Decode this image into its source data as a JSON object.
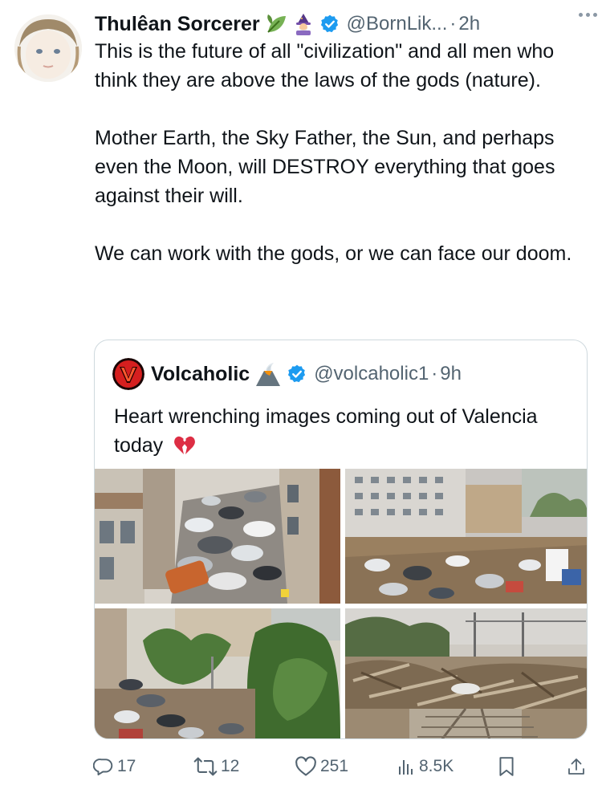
{
  "tweet": {
    "author_name": "Thulêan Sorcerer",
    "author_emojis": [
      "leaf-icon",
      "mage-icon"
    ],
    "handle": "@BornLik...",
    "separator": "·",
    "time": "2h",
    "paragraphs": [
      "This is the future of all \"civilization\" and all men who think they are above the laws of the gods (nature).",
      "Mother Earth, the Sky Father, the Sun, and perhaps even the Moon, will DESTROY everything that goes against their will.",
      "We can work with the gods, or we can face our doom."
    ]
  },
  "quoted": {
    "author_name": "Volcaholic",
    "author_emoji": "volcano-icon",
    "handle": "@volcaholic1",
    "separator": "·",
    "time": "9h",
    "text": "Heart wrenching images coming out of Valencia today",
    "text_emoji": "broken-heart-icon",
    "images": [
      "flood-cars-street-photo",
      "flood-plaza-photo",
      "flood-trees-photo",
      "flood-debris-railway-photo"
    ]
  },
  "actions": {
    "replies": "17",
    "reposts": "12",
    "likes": "251",
    "views": "8.5K"
  },
  "colors": {
    "text": "#0f1419",
    "muted": "#536471",
    "verified": "#1d9bf0",
    "border": "#cfd9de"
  }
}
